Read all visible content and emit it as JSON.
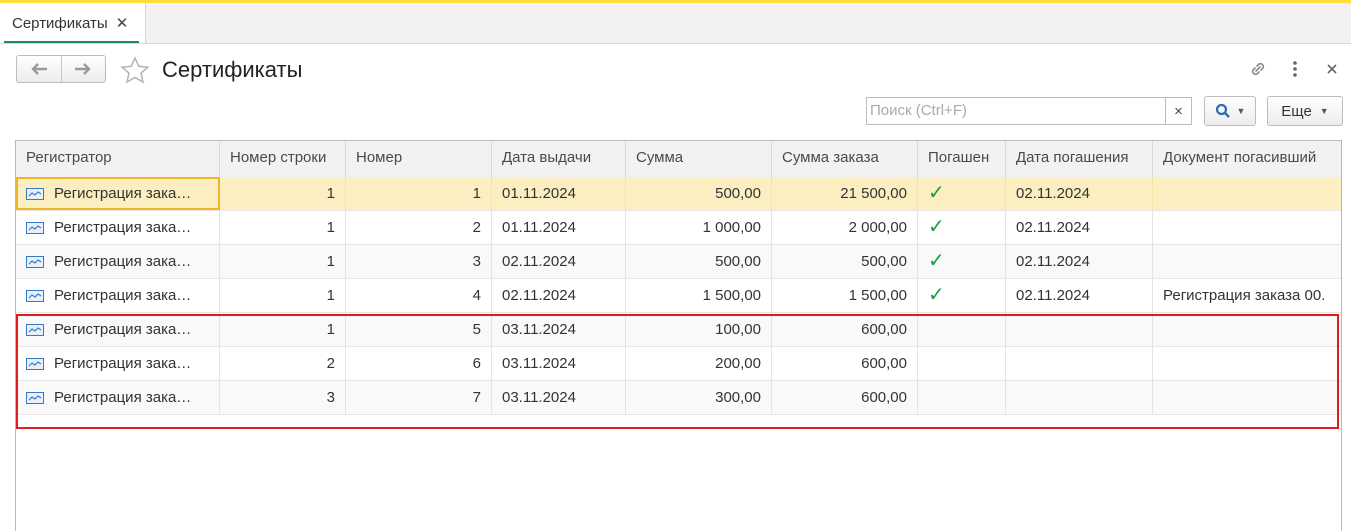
{
  "tab": {
    "label": "Сертификаты",
    "close": "✕"
  },
  "header": {
    "title": "Сертификаты"
  },
  "search": {
    "placeholder": "Поиск (Ctrl+F)",
    "clear": "×"
  },
  "toolbar": {
    "more_label": "Еще"
  },
  "table": {
    "columns": [
      "Регистратор",
      "Номер строки",
      "Номер",
      "Дата выдачи",
      "Сумма",
      "Сумма заказа",
      "Погашен",
      "Дата погашения",
      "Документ погасивший"
    ],
    "rows": [
      {
        "registrar": "Регистрация зака…",
        "line": "1",
        "number": "1",
        "issue_date": "01.11.2024",
        "sum": "500,00",
        "order_sum": "21 500,00",
        "paid": "✓",
        "paid_date": "02.11.2024",
        "doc": ""
      },
      {
        "registrar": "Регистрация зака…",
        "line": "1",
        "number": "2",
        "issue_date": "01.11.2024",
        "sum": "1 000,00",
        "order_sum": "2 000,00",
        "paid": "✓",
        "paid_date": "02.11.2024",
        "doc": ""
      },
      {
        "registrar": "Регистрация зака…",
        "line": "1",
        "number": "3",
        "issue_date": "02.11.2024",
        "sum": "500,00",
        "order_sum": "500,00",
        "paid": "✓",
        "paid_date": "02.11.2024",
        "doc": ""
      },
      {
        "registrar": "Регистрация зака…",
        "line": "1",
        "number": "4",
        "issue_date": "02.11.2024",
        "sum": "1 500,00",
        "order_sum": "1 500,00",
        "paid": "✓",
        "paid_date": "02.11.2024",
        "doc": "Регистрация заказа 00."
      },
      {
        "registrar": "Регистрация зака…",
        "line": "1",
        "number": "5",
        "issue_date": "03.11.2024",
        "sum": "100,00",
        "order_sum": "600,00",
        "paid": "",
        "paid_date": "",
        "doc": ""
      },
      {
        "registrar": "Регистрация зака…",
        "line": "2",
        "number": "6",
        "issue_date": "03.11.2024",
        "sum": "200,00",
        "order_sum": "600,00",
        "paid": "",
        "paid_date": "",
        "doc": ""
      },
      {
        "registrar": "Регистрация зака…",
        "line": "3",
        "number": "7",
        "issue_date": "03.11.2024",
        "sum": "300,00",
        "order_sum": "600,00",
        "paid": "",
        "paid_date": "",
        "doc": ""
      }
    ]
  },
  "colors": {
    "accent_tab": "#1e8c56",
    "top_stripe": "#ffdd3b",
    "selected_row": "#fbeec0",
    "check": "#1a9c4a",
    "highlight": "#e01c1c"
  }
}
